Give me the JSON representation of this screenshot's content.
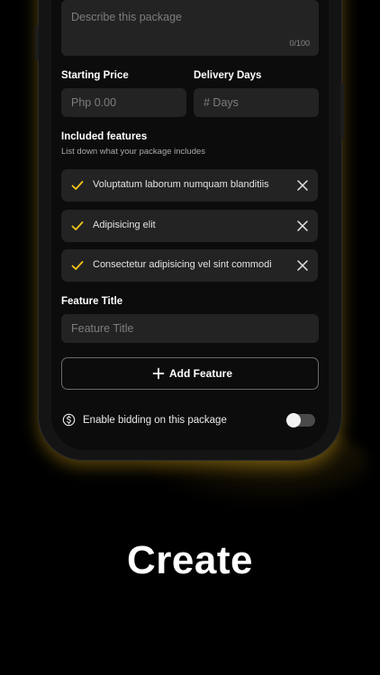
{
  "form": {
    "description": {
      "placeholder": "Describe this package",
      "counter": "0/100"
    },
    "starting_price": {
      "label": "Starting Price",
      "placeholder": "Php 0.00"
    },
    "delivery_days": {
      "label": "Delivery Days",
      "placeholder": "# Days"
    },
    "included_features": {
      "title": "Included features",
      "subtitle": "List down what your package includes",
      "items": [
        {
          "text": "Voluptatum laborum numquam blanditiis",
          "icon": "check-icon"
        },
        {
          "text": "Adipisicing elit",
          "icon": "check-icon"
        },
        {
          "text": "Consectetur adipisicing vel sint commodi",
          "icon": "check-icon"
        }
      ]
    },
    "feature_title": {
      "label": "Feature Title",
      "placeholder": "Feature Title"
    },
    "add_feature_label": "Add Feature",
    "bidding": {
      "label": "Enable bidding on this package",
      "icon": "dollar-circle-icon",
      "enabled": false
    }
  },
  "headline": "Create",
  "colors": {
    "background": "#000000",
    "field": "#232323",
    "accent": "#f5c518",
    "text": "#ffffff",
    "muted": "#7d7d7d"
  }
}
